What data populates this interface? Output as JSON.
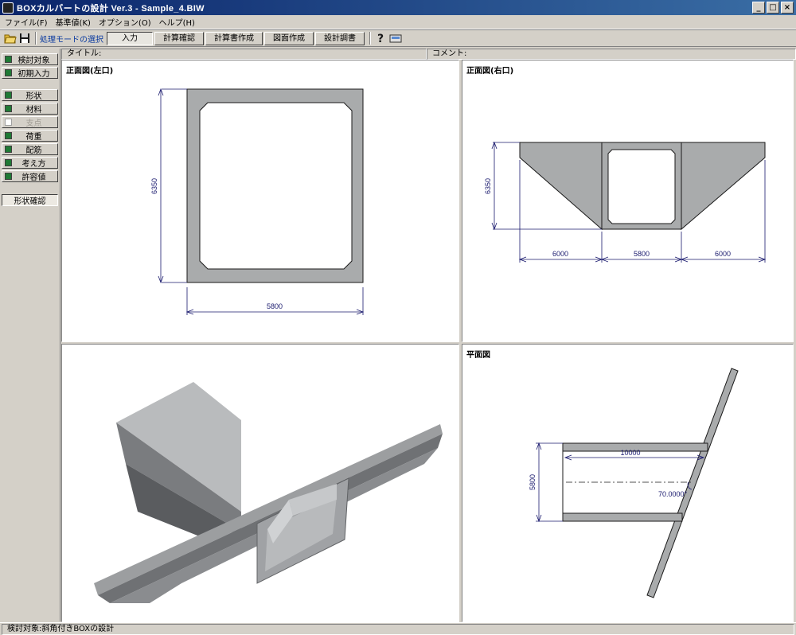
{
  "app": {
    "title": "BOXカルバートの設計 Ver.3 - Sample_4.BIW",
    "window_controls": [
      "minimize-icon",
      "maximize-icon",
      "close-icon"
    ]
  },
  "menu": [
    "ファイル(F)",
    "基準値(K)",
    "オプション(O)",
    "ヘルプ(H)"
  ],
  "toolbar": {
    "icons": [
      "open-folder-icon",
      "save-icon",
      "help-icon",
      "print-preview-icon"
    ],
    "mode_label": "処理モードの選択",
    "modes": [
      "入力",
      "計算確認",
      "計算書作成",
      "図面作成",
      "設計調書"
    ],
    "active_mode": "入力"
  },
  "sidebar": {
    "group1": [
      {
        "label": "検討対象",
        "checked": true
      },
      {
        "label": "初期入力",
        "checked": true
      }
    ],
    "group2": [
      {
        "label": "形状",
        "checked": true
      },
      {
        "label": "材料",
        "checked": true
      },
      {
        "label": "荷重",
        "checked": true
      },
      {
        "label": "配筋",
        "checked": true
      },
      {
        "label": "考え方",
        "checked": true
      },
      {
        "label": "許容値",
        "checked": true
      }
    ],
    "disabled_item": "支点",
    "selected_item": "形状確認"
  },
  "infobar": {
    "title_label": "タイトル:",
    "comment_label": "コメント:"
  },
  "views": {
    "front_left": {
      "title": "正面図(左口)",
      "height": "6350",
      "width": "5800"
    },
    "front_right": {
      "title": "正面図(右口)",
      "height": "6350",
      "left_wing": "6000",
      "center": "5800",
      "right_wing": "6000"
    },
    "plan": {
      "title": "平面図",
      "length": "10000",
      "width": "5800",
      "skew_angle": "70.0000°"
    },
    "model_3d": {
      "title": ""
    }
  },
  "status": "検討対象:斜角付きBOXの設計",
  "colors": {
    "titlebar": "#0a246a",
    "checkbox": "#1f7a35",
    "dimension": "#1a1a6e",
    "concrete": "#a9abac"
  }
}
